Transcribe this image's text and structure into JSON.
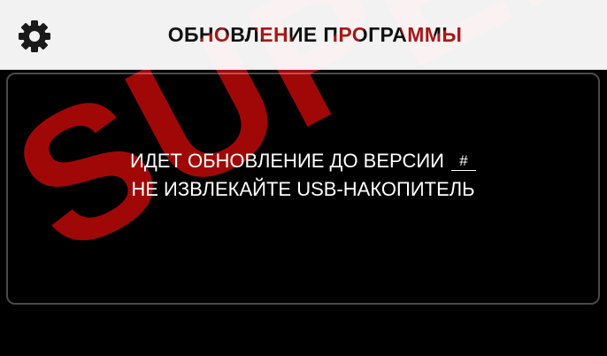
{
  "header": {
    "title": "ОБНОВЛЕНИЕ ПРОГРАММЫ",
    "settings_icon": "gear-icon"
  },
  "message": {
    "line1_text": "ИДЕТ ОБНОВЛЕНИЕ ДО ВЕРСИИ",
    "version": "#",
    "line2": "НЕ ИЗВЛЕКАЙТЕ USB-НАКОПИТЕЛЬ"
  },
  "watermark": {
    "text": "SUPER"
  },
  "colors": {
    "header_bg": "#f2f2f2",
    "screen_bg": "#000000",
    "text": "#ffffff",
    "watermark": "#cd0a0a"
  }
}
